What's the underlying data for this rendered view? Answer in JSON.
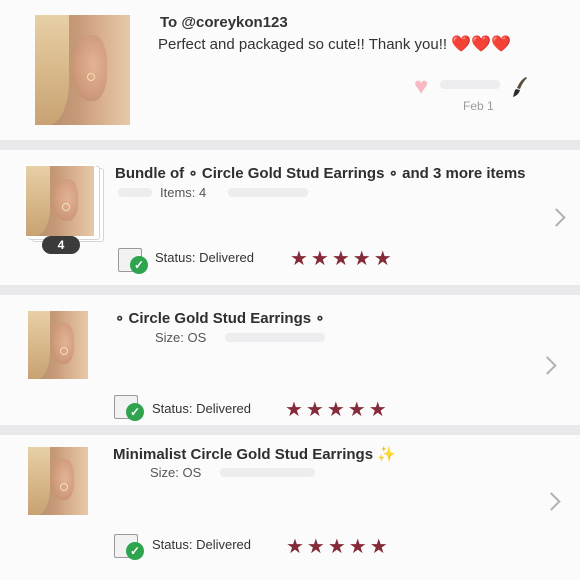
{
  "message": {
    "to_label": "To @coreykon123",
    "body": "Perfect and packaged so cute!! Thank you!! ",
    "hearts": "❤️❤️❤️",
    "date": "Feb 1"
  },
  "orders": [
    {
      "title": "Bundle of ∘ Circle Gold Stud Earrings ∘ and 3 more items",
      "meta": "Items: 4",
      "item_count_badge": "4",
      "status_label": "Status:",
      "status_value": "Delivered",
      "rating": 5,
      "stars": "★★★★★"
    },
    {
      "title": "∘ Circle Gold Stud Earrings ∘",
      "meta": "Size: OS",
      "status_label": "Status:",
      "status_value": "Delivered",
      "rating": 5,
      "stars": "★★★★★"
    },
    {
      "title": "Minimalist Circle Gold Stud Earrings ✨",
      "meta": "Size: OS",
      "status_label": "Status:",
      "status_value": "Delivered",
      "rating": 5,
      "stars": "★★★★★"
    }
  ],
  "icons": {
    "delivered": "box-with-check-icon",
    "chevron": "chevron-right-icon",
    "like": "heart-icon"
  },
  "colors": {
    "star": "#852a38",
    "check": "#2ea44f",
    "like_heart": "#f7b9c2"
  }
}
